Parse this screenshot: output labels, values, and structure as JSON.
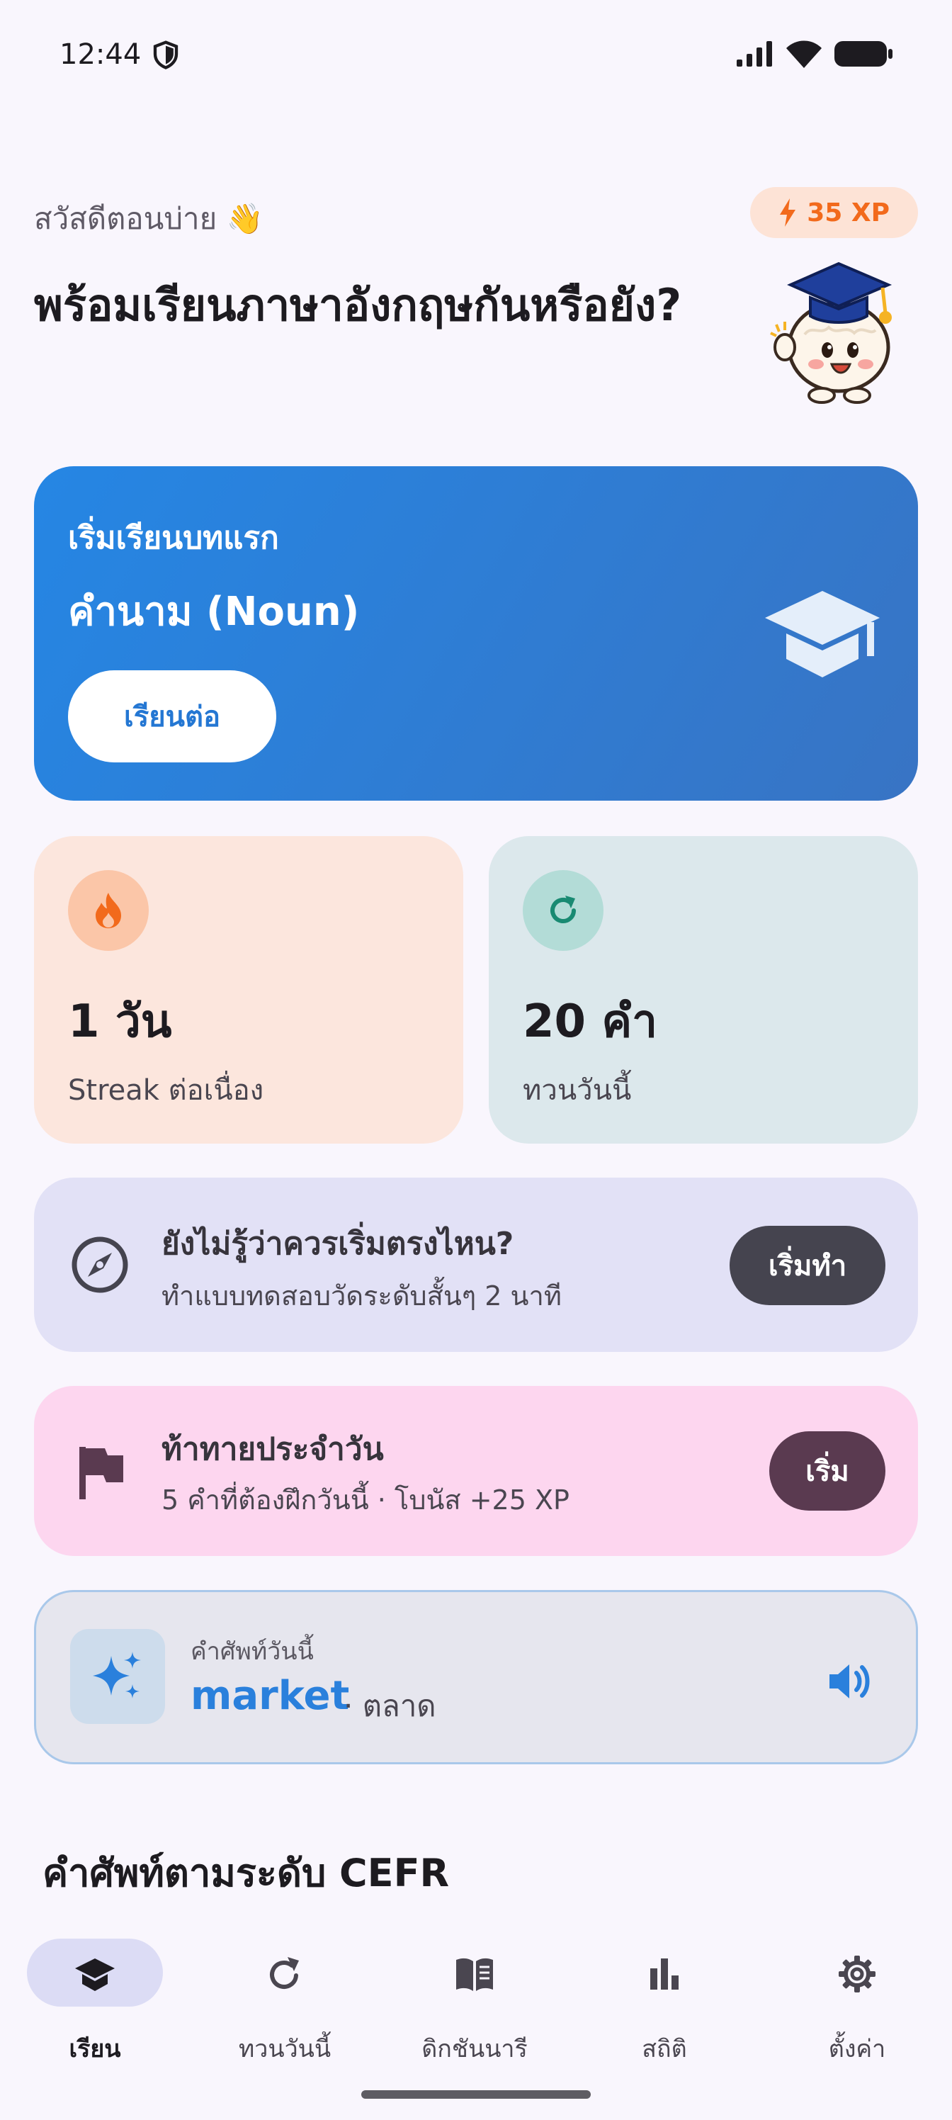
{
  "status_bar": {
    "time": "12:44"
  },
  "header": {
    "greeting": "สวัสดีตอนบ่าย 👋",
    "xp": "35 XP",
    "headline": "พร้อมเรียนภาษาอังกฤษกันหรือยัง?"
  },
  "hero": {
    "subtitle": "เริ่มเรียนบทแรก",
    "title": "คำนาม (Noun)",
    "button": "เรียนต่อ"
  },
  "stats": {
    "streak_value": "1 วัน",
    "streak_label": "Streak ต่อเนื่อง",
    "review_value": "20 คำ",
    "review_label": "ทวนวันนี้"
  },
  "placement": {
    "title": "ยังไม่รู้ว่าควรเริ่มตรงไหน?",
    "desc": "ทำแบบทดสอบวัดระดับสั้นๆ 2 นาที",
    "button": "เริ่มทำ"
  },
  "challenge": {
    "title": "ท้าทายประจำวัน",
    "desc": "5 คำที่ต้องฝึกวันนี้ · โบนัส +25 XP",
    "button": "เริ่ม"
  },
  "word_of_day": {
    "label": "คำศัพท์วันนี้",
    "word": "market",
    "meaning": "· ตลาด"
  },
  "section": {
    "title": "คำศัพท์ตามระดับ CEFR"
  },
  "nav": {
    "items": [
      {
        "label": "เรียน",
        "icon": "graduation-cap-icon",
        "active": true
      },
      {
        "label": "ทวนวันนี้",
        "icon": "refresh-icon",
        "active": false
      },
      {
        "label": "ดิกชันนารี",
        "icon": "book-icon",
        "active": false
      },
      {
        "label": "สถิติ",
        "icon": "bar-chart-icon",
        "active": false
      },
      {
        "label": "ตั้งค่า",
        "icon": "gear-icon",
        "active": false
      }
    ]
  },
  "colors": {
    "accent": "#2586e4",
    "xp_orange": "#f26a1c",
    "streak_bg": "#fce6dd",
    "review_bg": "#dce8ec",
    "placement_bg": "#e2e1f6",
    "challenge_bg": "#fdd6ef"
  }
}
